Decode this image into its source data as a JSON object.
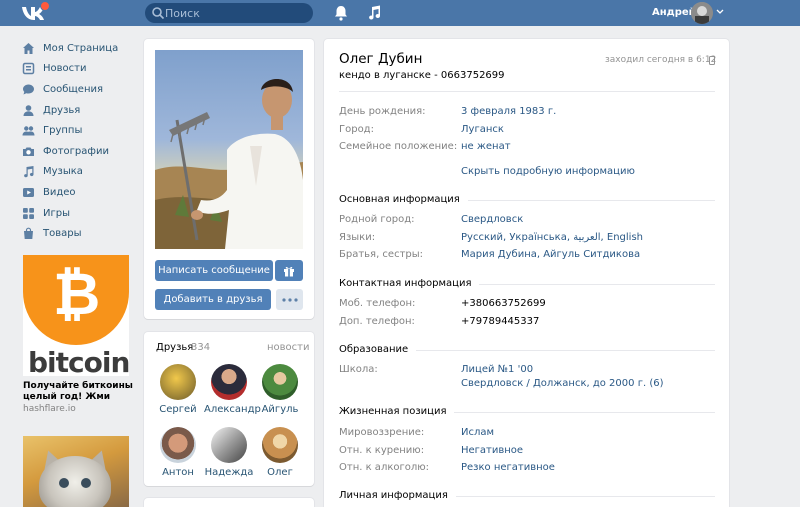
{
  "header": {
    "search_placeholder": "Поиск",
    "user_name": "Андрей",
    "colors": {
      "bar": "#4a76a8",
      "search_bg": "#224b7a"
    }
  },
  "nav": {
    "items": [
      {
        "label": "Моя Страница",
        "icon": "home-icon"
      },
      {
        "label": "Новости",
        "icon": "news-icon"
      },
      {
        "label": "Сообщения",
        "icon": "messages-icon"
      },
      {
        "label": "Друзья",
        "icon": "friends-icon"
      },
      {
        "label": "Группы",
        "icon": "groups-icon"
      },
      {
        "label": "Фотографии",
        "icon": "camera-icon"
      },
      {
        "label": "Музыка",
        "icon": "music-icon"
      },
      {
        "label": "Видео",
        "icon": "video-icon"
      },
      {
        "label": "Игры",
        "icon": "games-icon"
      },
      {
        "label": "Товары",
        "icon": "goods-icon"
      }
    ]
  },
  "ads": {
    "ad1": {
      "brand": "bitcoin",
      "symbol": "₿",
      "title": "Получайте биткоины целый год! Жми",
      "domain": "hashflare.io"
    }
  },
  "profile_actions": {
    "message_button": "Написать сообщение",
    "add_friend_button": "Добавить в друзья"
  },
  "friends": {
    "title": "Друзья",
    "count": "334",
    "link": "новости",
    "people": [
      {
        "name": "Сергей"
      },
      {
        "name": "Александр"
      },
      {
        "name": "Айгуль"
      },
      {
        "name": "Антон"
      },
      {
        "name": "Надежда"
      },
      {
        "name": "Олег"
      }
    ]
  },
  "profile": {
    "name": "Олег Дубин",
    "status": "кендо в луганске - 0663752699",
    "online": "заходил сегодня в 6:12",
    "basic": [
      {
        "label": "День рождения:",
        "value": "3 февраля 1983 г."
      },
      {
        "label": "Город:",
        "value": "Луганск"
      },
      {
        "label": "Семейное положение:",
        "value": "не женат"
      }
    ],
    "toggle_label": "Скрыть подробную информацию",
    "sections": {
      "main": {
        "title": "Основная информация",
        "rows": [
          {
            "label": "Родной город:",
            "value": "Свердловск"
          },
          {
            "label": "Языки:",
            "value": "Русский, Українська, العربية, English"
          },
          {
            "label": "Братья, сестры:",
            "value": "Мария Дубина, Айгуль Ситдикова"
          }
        ]
      },
      "contact": {
        "title": "Контактная информация",
        "rows": [
          {
            "label": "Моб. телефон:",
            "value": "+380663752699"
          },
          {
            "label": "Доп. телефон:",
            "value": "+79789445337"
          }
        ]
      },
      "education": {
        "title": "Образование",
        "school_label": "Школа:",
        "school_name": "Лицей №1 '00",
        "school_details": "Свердловск / Должанск, до 2000 г.",
        "school_count": "(6)"
      },
      "life": {
        "title": "Жизненная позиция",
        "rows": [
          {
            "label": "Мировоззрение:",
            "value": "Ислам"
          },
          {
            "label": "Отн. к курению:",
            "value": "Негативное"
          },
          {
            "label": "Отн. к алкоголю:",
            "value": "Резко негативное"
          }
        ]
      },
      "personal": {
        "title": "Личная информация"
      }
    }
  }
}
